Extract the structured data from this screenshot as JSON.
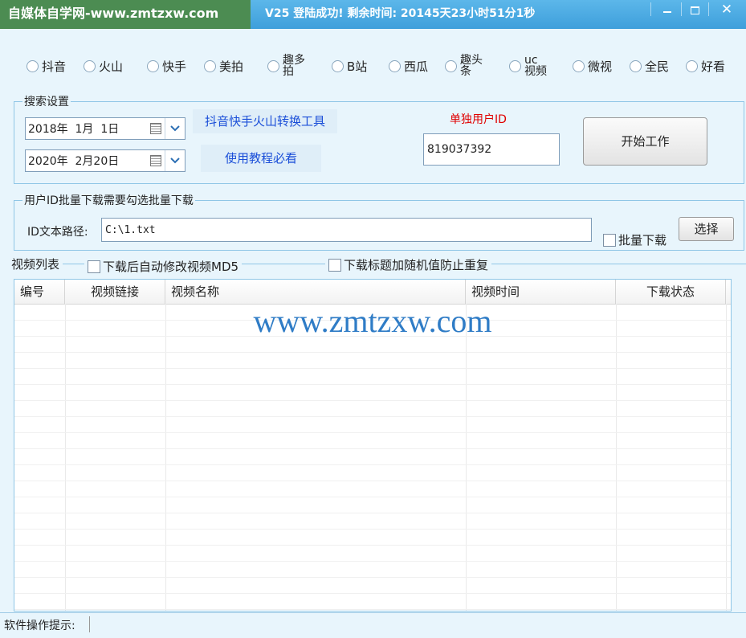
{
  "window": {
    "brand_title": "自媒体自学网-www.zmtzxw.com",
    "status_title": "V25  登陆成功! 剩余时间: 20145天23小时51分1秒"
  },
  "platforms": [
    "抖音",
    "火山",
    "快手",
    "美拍",
    "趣多拍",
    "B站",
    "西瓜",
    "趣头条",
    "uc视频",
    "微视",
    "全民",
    "好看"
  ],
  "search_settings": {
    "legend": "搜索设置",
    "start_date": "2018年  1月  1日",
    "end_date": "2020年  2月20日",
    "tool_link": "抖音快手火山转换工具",
    "tutorial_link": "使用教程必看",
    "user_id_label": "单独用户ID",
    "user_id_value": "819037392",
    "start_button": "开始工作"
  },
  "batch": {
    "legend": "用户ID批量下载需要勾选批量下载",
    "path_label": "ID文本路径:",
    "path_value": "C:\\1.txt",
    "batch_checkbox": "批量下载",
    "choose_button": "选择"
  },
  "video_list": {
    "legend": "视频列表",
    "md5_checkbox": "下载后自动修改视频MD5",
    "random_checkbox": "下载标题加随机值防止重复",
    "columns": [
      "编号",
      "视频链接",
      "视频名称",
      "视频时间",
      "下载状态"
    ],
    "watermark": "www.zmtzxw.com"
  },
  "status_bar": {
    "label": "软件操作提示:"
  }
}
